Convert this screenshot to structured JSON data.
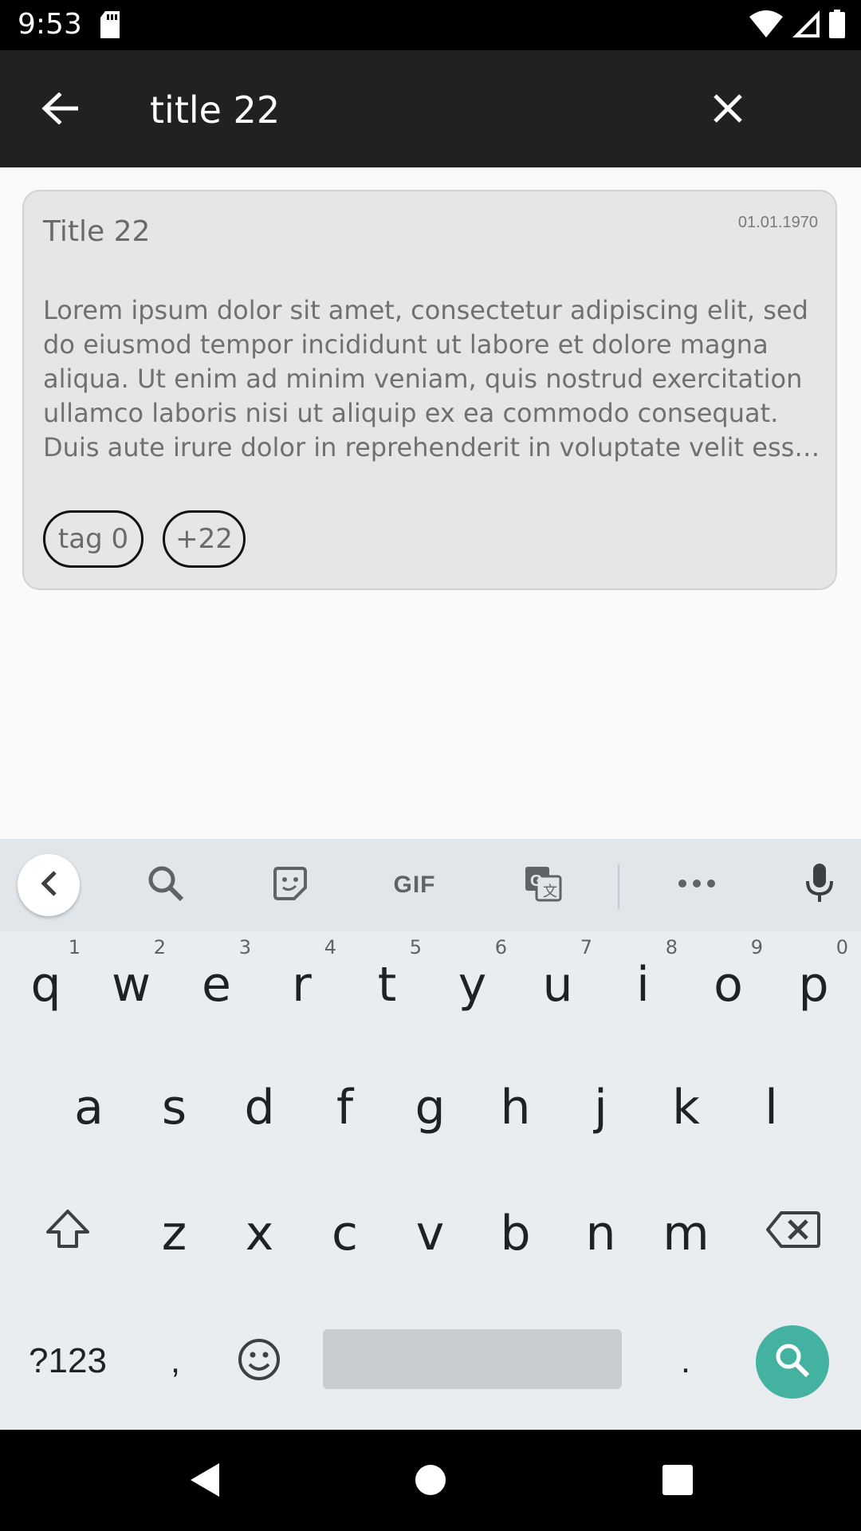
{
  "status_bar": {
    "time": "9:53"
  },
  "toolbar": {
    "query": "title 22"
  },
  "card": {
    "title": "Title 22",
    "date": "01.01.1970",
    "body": "Lorem ipsum dolor sit amet, consectetur adipiscing elit, sed do eiusmod tempor incididunt ut labore et dolore magna aliqua. Ut enim ad minim veniam, quis nostrud exercitation ullamco laboris nisi ut aliquip ex ea commodo consequat. Duis aute irure dolor in reprehenderit in voluptate velit esse cillum dolore eu fugiat nulla pariatur.",
    "tags": [
      "tag 0",
      "+22"
    ]
  },
  "keyboard": {
    "toolbar": {
      "gif_label": "GIF"
    },
    "row1": [
      {
        "key": "q",
        "hint": "1"
      },
      {
        "key": "w",
        "hint": "2"
      },
      {
        "key": "e",
        "hint": "3"
      },
      {
        "key": "r",
        "hint": "4"
      },
      {
        "key": "t",
        "hint": "5"
      },
      {
        "key": "y",
        "hint": "6"
      },
      {
        "key": "u",
        "hint": "7"
      },
      {
        "key": "i",
        "hint": "8"
      },
      {
        "key": "o",
        "hint": "9"
      },
      {
        "key": "p",
        "hint": "0"
      }
    ],
    "row2": [
      "a",
      "s",
      "d",
      "f",
      "g",
      "h",
      "j",
      "k",
      "l"
    ],
    "row3": [
      "z",
      "x",
      "c",
      "v",
      "b",
      "n",
      "m"
    ],
    "bottom": {
      "symbols": "?123",
      "comma": ",",
      "period": "."
    }
  }
}
